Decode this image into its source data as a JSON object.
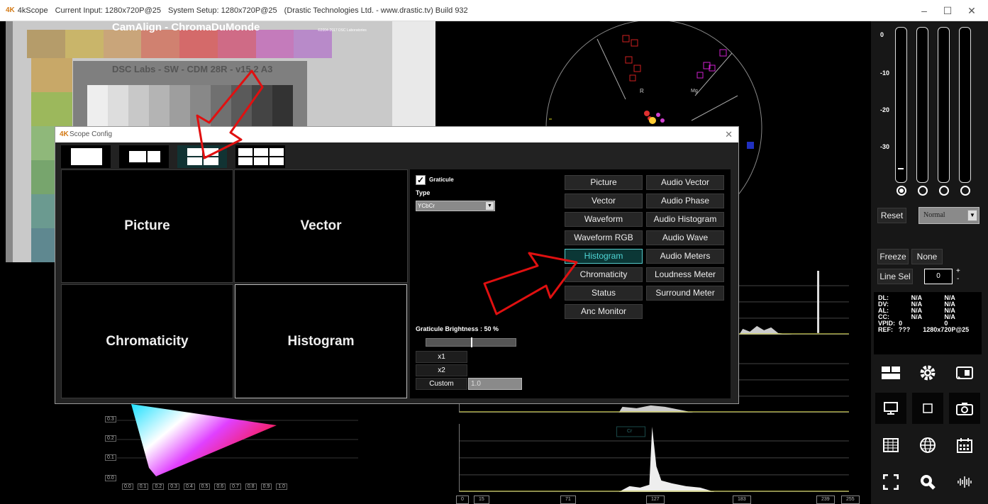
{
  "window": {
    "app_name": "4kScope",
    "current_input": "Current Input: 1280x720P@25",
    "system_setup": "System Setup: 1280x720P@25",
    "vendor": "(Drastic Technologies Ltd. - www.drastic.tv) Build 932",
    "minimize": "–",
    "maximize": "☐",
    "close": "✕"
  },
  "picture": {
    "chart_title": "CamAlign - ChromaDuMonde",
    "copyright": "©2004-2017 DSC Laboratories",
    "inner_title": "DSC Labs - SW - CDM 28R - v15.2 A3"
  },
  "vectorscope": {
    "label_r": "R",
    "label_mg": "Mg"
  },
  "histogram_axis": [
    "0",
    "15",
    "71",
    "127",
    "183",
    "239",
    "255"
  ],
  "histogram_marker": "Cr",
  "chroma_axis": {
    "x_ticks": [
      "0.0",
      "0.1",
      "0.2",
      "0.3",
      "0.4",
      "0.5",
      "0.6",
      "0.7",
      "0.8",
      "0.9",
      "1.0"
    ],
    "y_ticks": [
      "0.3",
      "0.2",
      "0.1",
      "0.0"
    ]
  },
  "right_panel": {
    "meter_labels": [
      "0",
      "-10",
      "-20",
      "-30"
    ],
    "reset": "Reset",
    "mode": "Normal",
    "freeze": "Freeze",
    "none": "None",
    "line_sel": "Line Sel",
    "line_value": "0",
    "plus": "+",
    "minus": "-",
    "status": [
      {
        "k": "DL:",
        "a": "N/A",
        "b": "N/A"
      },
      {
        "k": "DV:",
        "a": "N/A",
        "b": "N/A"
      },
      {
        "k": "AL:",
        "a": "N/A",
        "b": "N/A"
      },
      {
        "k": "CC:",
        "a": "N/A",
        "b": "N/A"
      },
      {
        "k": "VPID:",
        "a": "0",
        "b": "0"
      },
      {
        "k": "REF:",
        "a": "???",
        "b": "1280x720P@25"
      }
    ]
  },
  "dialog": {
    "title": "Scope Config",
    "close": "✕",
    "cells": [
      "Picture",
      "Vector",
      "Chromaticity",
      "Histogram"
    ],
    "graticule_checked": "✓",
    "graticule": "Graticule",
    "type_label": "Type",
    "type_value": "YCbCr",
    "brightness_label": "Graticule Brightness : 50 %",
    "brightness": 0.5,
    "zoom_x1": "x1",
    "zoom_x2": "x2",
    "zoom_custom": "Custom",
    "custom_value": "1.0",
    "scopes_left": [
      "Picture",
      "Vector",
      "Waveform",
      "Waveform RGB",
      "Histogram",
      "Chromaticity",
      "Status",
      "Anc Monitor"
    ],
    "scopes_right": [
      "Audio Vector",
      "Audio Phase",
      "Audio Histogram",
      "Audio Wave",
      "Audio Meters",
      "Loudness Meter",
      "Surround Meter"
    ],
    "selected_scope": "Histogram"
  }
}
